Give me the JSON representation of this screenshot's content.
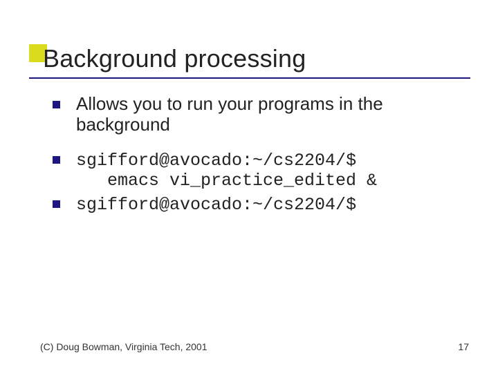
{
  "title": "Background processing",
  "bullets": [
    {
      "text": "Allows you to run your programs in the background"
    },
    {
      "line1": "sgifford@avocado:~/cs2204/$",
      "line2": "emacs vi_practice_edited &"
    },
    {
      "text": "sgifford@avocado:~/cs2204/$"
    }
  ],
  "footer": {
    "left": "(C) Doug Bowman, Virginia Tech, 2001",
    "right": "17"
  },
  "colors": {
    "accent_square": "#dadb1d",
    "rule_and_bullets": "#1e1680"
  }
}
